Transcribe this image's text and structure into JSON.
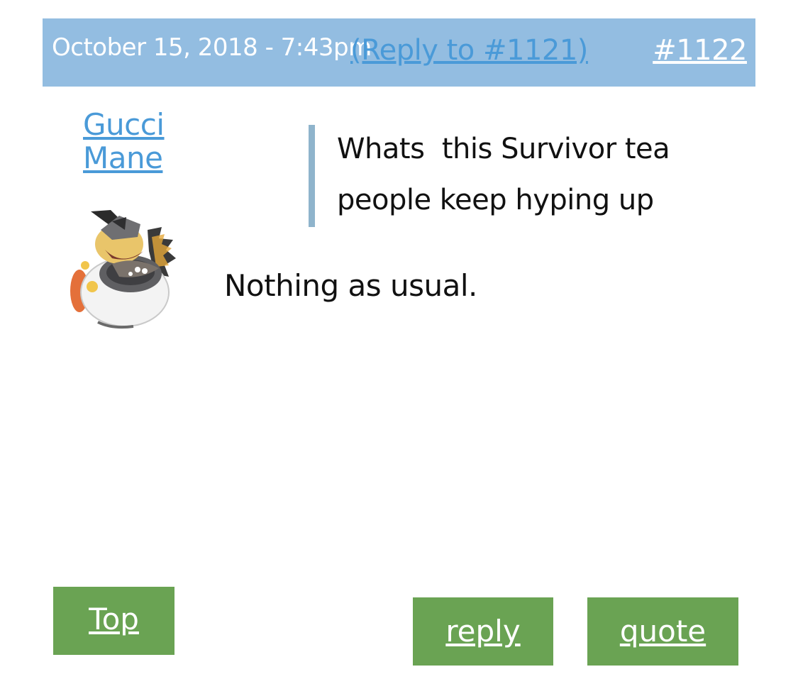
{
  "header": {
    "date": "October 15, 2018 - 7:43pm",
    "reply_to": "(Reply to #1121)",
    "post_number": "#1122"
  },
  "author": {
    "name": "Gucci Mane"
  },
  "quote": {
    "text": "Whats  this Survivor tea people keep hyping up"
  },
  "body": {
    "text": "Nothing as usual."
  },
  "buttons": {
    "top": "Top",
    "reply": "reply",
    "quote": "quote"
  },
  "colors": {
    "header_bg": "#93bde1",
    "link": "#4a9ad8",
    "button_bg": "#6aa353",
    "quote_bar": "#8fb4cc"
  },
  "icons": {
    "avatar": "character-avatar"
  }
}
